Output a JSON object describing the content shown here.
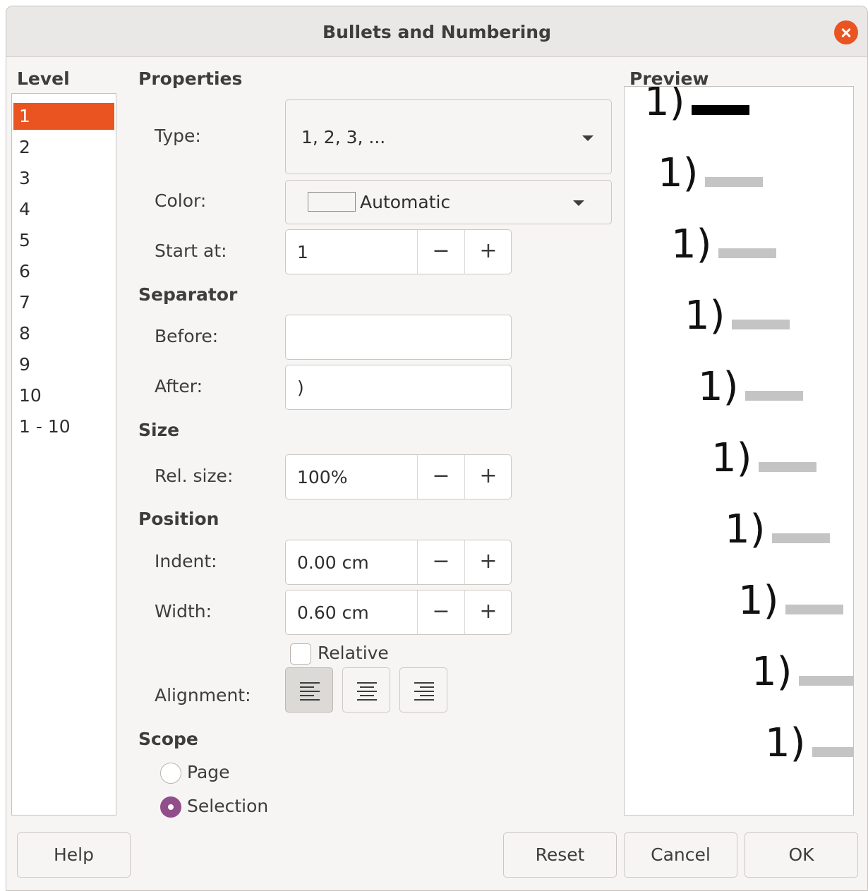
{
  "window": {
    "title": "Bullets and Numbering"
  },
  "level": {
    "heading": "Level",
    "items": [
      "1",
      "2",
      "3",
      "4",
      "5",
      "6",
      "7",
      "8",
      "9",
      "10",
      "1 - 10"
    ],
    "selected": "1"
  },
  "properties": {
    "heading": "Properties",
    "type_label": "Type:",
    "type_value": "1, 2, 3, ...",
    "color_label": "Color:",
    "color_value": "Automatic",
    "start_label": "Start at:",
    "start_value": "1"
  },
  "separator": {
    "heading": "Separator",
    "before_label": "Before:",
    "before_value": "",
    "after_label": "After:",
    "after_value": ")"
  },
  "size": {
    "heading": "Size",
    "rel_label": "Rel. size:",
    "rel_value": "100%"
  },
  "position": {
    "heading": "Position",
    "indent_label": "Indent:",
    "indent_value": "0.00 cm",
    "width_label": "Width:",
    "width_value": "0.60 cm",
    "relative_label": "Relative",
    "relative_checked": false,
    "alignment_label": "Alignment:",
    "alignment_selected": "left"
  },
  "scope": {
    "heading": "Scope",
    "page_label": "Page",
    "selection_label": "Selection",
    "selected": "Selection"
  },
  "preview": {
    "heading": "Preview",
    "item_text": "1)"
  },
  "buttons": {
    "help": "Help",
    "reset": "Reset",
    "cancel": "Cancel",
    "ok": "OK"
  },
  "spin": {
    "minus": "−",
    "plus": "+"
  },
  "colors": {
    "accent": "#e95420",
    "radio": "#924d8b"
  }
}
